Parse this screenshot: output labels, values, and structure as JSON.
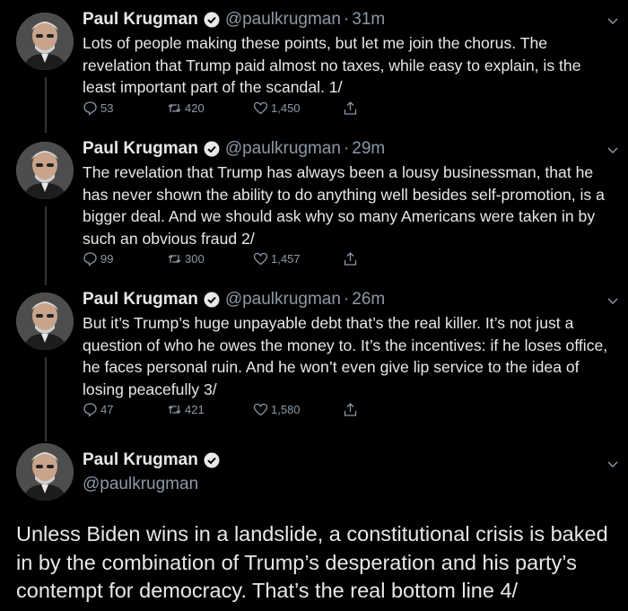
{
  "author": {
    "name": "Paul Krugman",
    "handle": "@paulkrugman",
    "dot": "·"
  },
  "tweets": [
    {
      "time": "31m",
      "text": "Lots of people making these points, but let me join the chorus. The revelation that Trump paid almost no taxes, while easy to explain, is the least important part of the scandal. 1/",
      "replies": "53",
      "retweets": "420",
      "likes": "1,450"
    },
    {
      "time": "29m",
      "text": "The revelation that Trump has always been a lousy businessman, that he has never shown the ability to do anything well besides self-promotion, is a bigger deal. And we should ask why so many Americans were taken in by such an obvious fraud 2/",
      "replies": "99",
      "retweets": "300",
      "likes": "1,457"
    },
    {
      "time": "26m",
      "text": "But it’s Trump’s huge unpayable debt that’s the real killer. It’s not just a question of who he owes the money to. It’s the incentives: if he loses office, he faces personal ruin. And he won’t even give lip service to the idea of losing peacefully 3/",
      "replies": "47",
      "retweets": "421",
      "likes": "1,580"
    }
  ],
  "final_tweet": {
    "name": "Paul Krugman",
    "handle": "@paulkrugman",
    "text": "Unless Biden wins in a landslide, a constitutional crisis is baked in by the combination of Trump’s desperation and his party’s contempt for democracy. That’s the real bottom line 4/"
  },
  "icons": {
    "verified": "verified-badge-icon",
    "reply": "reply-icon",
    "retweet": "retweet-icon",
    "like": "heart-icon",
    "share": "share-icon",
    "more": "chevron-down-icon"
  },
  "colors": {
    "background": "#000000",
    "text": "#e8e8e8",
    "muted": "#8b98a5",
    "thread_line": "#2f3336"
  }
}
